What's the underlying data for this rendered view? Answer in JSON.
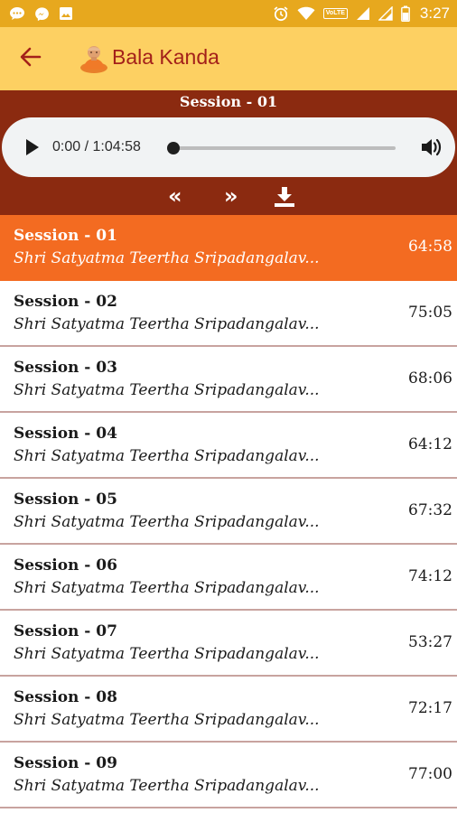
{
  "colors": {
    "status_bar": "#e7a81e",
    "app_bar": "#fdd062",
    "title": "#a3201a",
    "player_panel": "#8b2a10",
    "active_row": "#f36b21",
    "divider": "#c8a39f"
  },
  "status_bar": {
    "left_icons": [
      "message-icon",
      "messenger-icon",
      "image-icon"
    ],
    "right_icons": [
      "alarm-icon",
      "wifi-icon",
      "volte-badge",
      "signal-icon",
      "signal-icon",
      "battery-icon"
    ],
    "volte_label": "VoLTE",
    "time": "3:27"
  },
  "app_bar": {
    "back_icon": "arrow-left-icon",
    "logo_icon": "saint-avatar-icon",
    "title": "Bala Kanda"
  },
  "player": {
    "now_playing": "Session - 01",
    "time_display": "0:00 / 1:04:58",
    "progress": 0,
    "controls": {
      "prev": "«",
      "next": "»",
      "download_icon": "download-icon"
    }
  },
  "sessions": [
    {
      "title": "Session - 01",
      "subtitle": "Shri Satyatma Teertha Sripadangalav...",
      "duration": "64:58",
      "active": true
    },
    {
      "title": "Session - 02",
      "subtitle": "Shri Satyatma Teertha Sripadangalav...",
      "duration": "75:05",
      "active": false
    },
    {
      "title": "Session - 03",
      "subtitle": "Shri Satyatma Teertha Sripadangalav...",
      "duration": "68:06",
      "active": false
    },
    {
      "title": "Session - 04",
      "subtitle": "Shri Satyatma Teertha Sripadangalav...",
      "duration": "64:12",
      "active": false
    },
    {
      "title": "Session - 05",
      "subtitle": "Shri Satyatma Teertha Sripadangalav...",
      "duration": "67:32",
      "active": false
    },
    {
      "title": "Session - 06",
      "subtitle": "Shri Satyatma Teertha Sripadangalav...",
      "duration": "74:12",
      "active": false
    },
    {
      "title": "Session - 07",
      "subtitle": "Shri Satyatma Teertha Sripadangalav...",
      "duration": "53:27",
      "active": false
    },
    {
      "title": "Session - 08",
      "subtitle": "Shri Satyatma Teertha Sripadangalav...",
      "duration": "72:17",
      "active": false
    },
    {
      "title": "Session - 09",
      "subtitle": "Shri Satyatma Teertha Sripadangalav...",
      "duration": "77:00",
      "active": false
    }
  ]
}
